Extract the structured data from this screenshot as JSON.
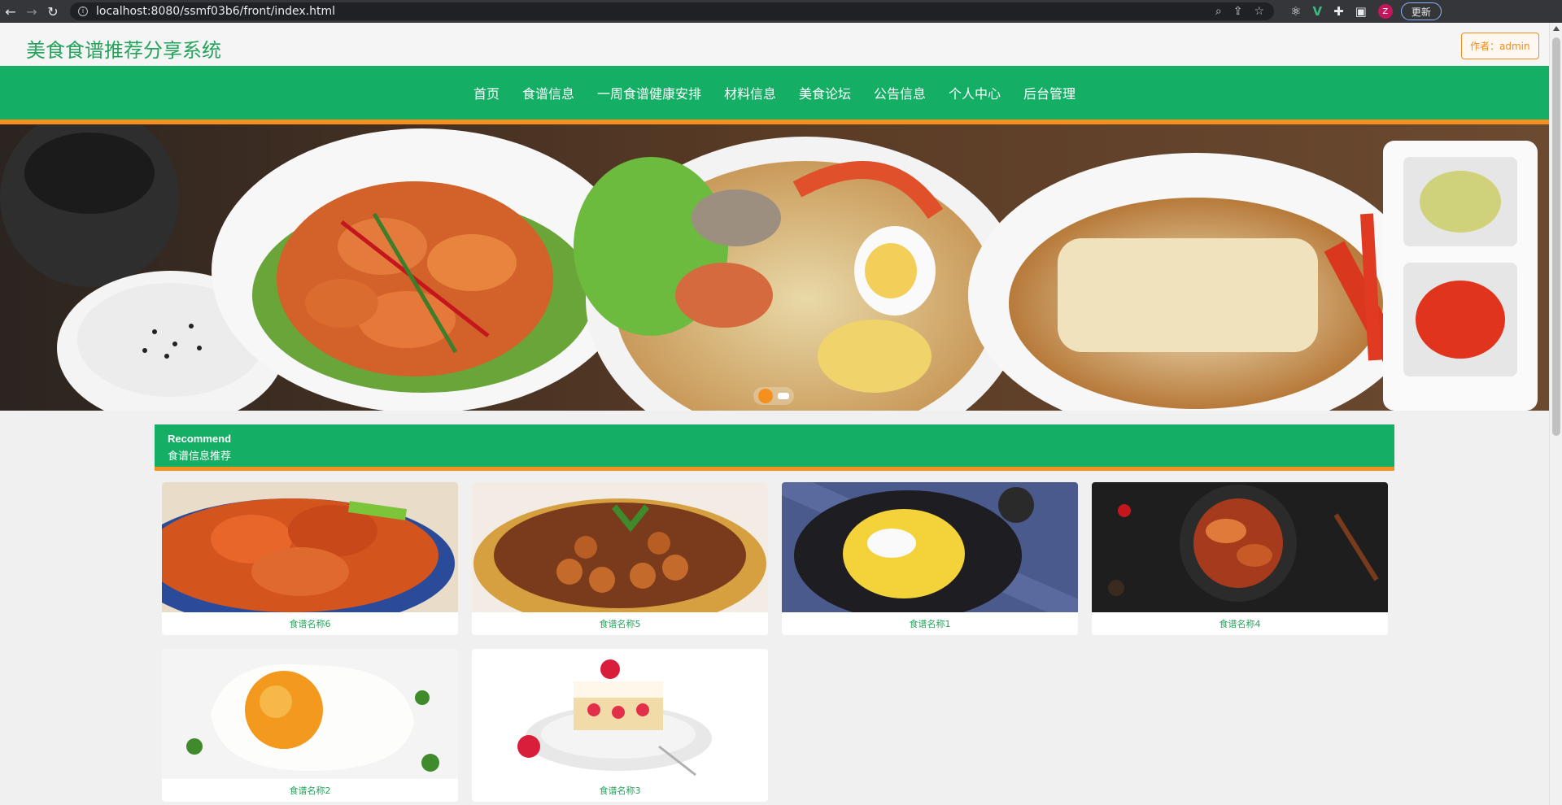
{
  "browser": {
    "url": "localhost:8080/ssmf03b6/front/index.html",
    "avatar_letter": "Z",
    "update_label": "更新"
  },
  "header": {
    "site_title": "美食食谱推荐分享系统",
    "author_label": "作者：admin"
  },
  "nav": {
    "items": [
      "首页",
      "食谱信息",
      "一周食谱健康安排",
      "材料信息",
      "美食论坛",
      "公告信息",
      "个人中心",
      "后台管理"
    ]
  },
  "colors": {
    "brand_green": "#14ae64",
    "accent_orange": "#f5901e",
    "title_green": "#25a35c"
  },
  "recommend": {
    "title_en": "Recommend",
    "title_cn": "食谱信息推荐",
    "cards": [
      {
        "name": "食谱名称6"
      },
      {
        "name": "食谱名称5"
      },
      {
        "name": "食谱名称1"
      },
      {
        "name": "食谱名称4"
      },
      {
        "name": "食谱名称2"
      },
      {
        "name": "食谱名称3"
      }
    ]
  }
}
